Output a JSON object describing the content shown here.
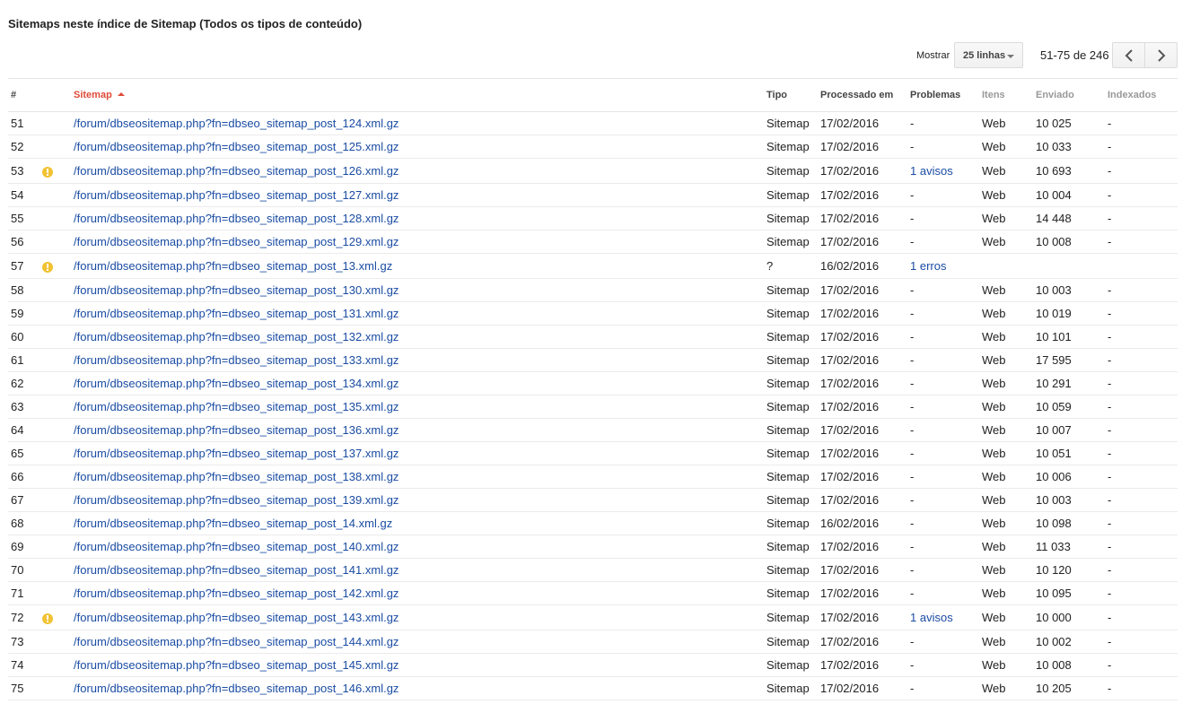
{
  "title": "Sitemaps neste índice de Sitemap (Todos os tipos de conteúdo)",
  "controls": {
    "show_label": "Mostrar",
    "rows_value": "25 linhas",
    "pager_text": "51-75 de 246"
  },
  "columns": {
    "num": "#",
    "sitemap": "Sitemap",
    "type": "Tipo",
    "processed": "Processado em",
    "issues": "Problemas",
    "items": "Itens",
    "submitted": "Enviado",
    "indexed": "Indexados"
  },
  "colors": {
    "link": "#1a4ca3",
    "sorted_header": "#dd4b39",
    "warning": "#f1c232"
  },
  "rows": [
    {
      "num": "51",
      "warn": false,
      "url": "/forum/dbseositemap.php?fn=dbseo_sitemap_post_124.xml.gz",
      "type": "Sitemap",
      "processed": "17/02/2016",
      "issues": "-",
      "issues_link": false,
      "items": "Web",
      "submitted": "10 025",
      "indexed": "-"
    },
    {
      "num": "52",
      "warn": false,
      "url": "/forum/dbseositemap.php?fn=dbseo_sitemap_post_125.xml.gz",
      "type": "Sitemap",
      "processed": "17/02/2016",
      "issues": "-",
      "issues_link": false,
      "items": "Web",
      "submitted": "10 033",
      "indexed": "-"
    },
    {
      "num": "53",
      "warn": true,
      "url": "/forum/dbseositemap.php?fn=dbseo_sitemap_post_126.xml.gz",
      "type": "Sitemap",
      "processed": "17/02/2016",
      "issues": "1 avisos",
      "issues_link": true,
      "items": "Web",
      "submitted": "10 693",
      "indexed": "-"
    },
    {
      "num": "54",
      "warn": false,
      "url": "/forum/dbseositemap.php?fn=dbseo_sitemap_post_127.xml.gz",
      "type": "Sitemap",
      "processed": "17/02/2016",
      "issues": "-",
      "issues_link": false,
      "items": "Web",
      "submitted": "10 004",
      "indexed": "-"
    },
    {
      "num": "55",
      "warn": false,
      "url": "/forum/dbseositemap.php?fn=dbseo_sitemap_post_128.xml.gz",
      "type": "Sitemap",
      "processed": "17/02/2016",
      "issues": "-",
      "issues_link": false,
      "items": "Web",
      "submitted": "14 448",
      "indexed": "-"
    },
    {
      "num": "56",
      "warn": false,
      "url": "/forum/dbseositemap.php?fn=dbseo_sitemap_post_129.xml.gz",
      "type": "Sitemap",
      "processed": "17/02/2016",
      "issues": "-",
      "issues_link": false,
      "items": "Web",
      "submitted": "10 008",
      "indexed": "-"
    },
    {
      "num": "57",
      "warn": true,
      "url": "/forum/dbseositemap.php?fn=dbseo_sitemap_post_13.xml.gz",
      "type": "?",
      "processed": "16/02/2016",
      "issues": "1 erros",
      "issues_link": true,
      "items": "",
      "submitted": "",
      "indexed": ""
    },
    {
      "num": "58",
      "warn": false,
      "url": "/forum/dbseositemap.php?fn=dbseo_sitemap_post_130.xml.gz",
      "type": "Sitemap",
      "processed": "17/02/2016",
      "issues": "-",
      "issues_link": false,
      "items": "Web",
      "submitted": "10 003",
      "indexed": "-"
    },
    {
      "num": "59",
      "warn": false,
      "url": "/forum/dbseositemap.php?fn=dbseo_sitemap_post_131.xml.gz",
      "type": "Sitemap",
      "processed": "17/02/2016",
      "issues": "-",
      "issues_link": false,
      "items": "Web",
      "submitted": "10 019",
      "indexed": "-"
    },
    {
      "num": "60",
      "warn": false,
      "url": "/forum/dbseositemap.php?fn=dbseo_sitemap_post_132.xml.gz",
      "type": "Sitemap",
      "processed": "17/02/2016",
      "issues": "-",
      "issues_link": false,
      "items": "Web",
      "submitted": "10 101",
      "indexed": "-"
    },
    {
      "num": "61",
      "warn": false,
      "url": "/forum/dbseositemap.php?fn=dbseo_sitemap_post_133.xml.gz",
      "type": "Sitemap",
      "processed": "17/02/2016",
      "issues": "-",
      "issues_link": false,
      "items": "Web",
      "submitted": "17 595",
      "indexed": "-"
    },
    {
      "num": "62",
      "warn": false,
      "url": "/forum/dbseositemap.php?fn=dbseo_sitemap_post_134.xml.gz",
      "type": "Sitemap",
      "processed": "17/02/2016",
      "issues": "-",
      "issues_link": false,
      "items": "Web",
      "submitted": "10 291",
      "indexed": "-"
    },
    {
      "num": "63",
      "warn": false,
      "url": "/forum/dbseositemap.php?fn=dbseo_sitemap_post_135.xml.gz",
      "type": "Sitemap",
      "processed": "17/02/2016",
      "issues": "-",
      "issues_link": false,
      "items": "Web",
      "submitted": "10 059",
      "indexed": "-"
    },
    {
      "num": "64",
      "warn": false,
      "url": "/forum/dbseositemap.php?fn=dbseo_sitemap_post_136.xml.gz",
      "type": "Sitemap",
      "processed": "17/02/2016",
      "issues": "-",
      "issues_link": false,
      "items": "Web",
      "submitted": "10 007",
      "indexed": "-"
    },
    {
      "num": "65",
      "warn": false,
      "url": "/forum/dbseositemap.php?fn=dbseo_sitemap_post_137.xml.gz",
      "type": "Sitemap",
      "processed": "17/02/2016",
      "issues": "-",
      "issues_link": false,
      "items": "Web",
      "submitted": "10 051",
      "indexed": "-"
    },
    {
      "num": "66",
      "warn": false,
      "url": "/forum/dbseositemap.php?fn=dbseo_sitemap_post_138.xml.gz",
      "type": "Sitemap",
      "processed": "17/02/2016",
      "issues": "-",
      "issues_link": false,
      "items": "Web",
      "submitted": "10 006",
      "indexed": "-"
    },
    {
      "num": "67",
      "warn": false,
      "url": "/forum/dbseositemap.php?fn=dbseo_sitemap_post_139.xml.gz",
      "type": "Sitemap",
      "processed": "17/02/2016",
      "issues": "-",
      "issues_link": false,
      "items": "Web",
      "submitted": "10 003",
      "indexed": "-"
    },
    {
      "num": "68",
      "warn": false,
      "url": "/forum/dbseositemap.php?fn=dbseo_sitemap_post_14.xml.gz",
      "type": "Sitemap",
      "processed": "16/02/2016",
      "issues": "-",
      "issues_link": false,
      "items": "Web",
      "submitted": "10 098",
      "indexed": "-"
    },
    {
      "num": "69",
      "warn": false,
      "url": "/forum/dbseositemap.php?fn=dbseo_sitemap_post_140.xml.gz",
      "type": "Sitemap",
      "processed": "17/02/2016",
      "issues": "-",
      "issues_link": false,
      "items": "Web",
      "submitted": "11 033",
      "indexed": "-"
    },
    {
      "num": "70",
      "warn": false,
      "url": "/forum/dbseositemap.php?fn=dbseo_sitemap_post_141.xml.gz",
      "type": "Sitemap",
      "processed": "17/02/2016",
      "issues": "-",
      "issues_link": false,
      "items": "Web",
      "submitted": "10 120",
      "indexed": "-"
    },
    {
      "num": "71",
      "warn": false,
      "url": "/forum/dbseositemap.php?fn=dbseo_sitemap_post_142.xml.gz",
      "type": "Sitemap",
      "processed": "17/02/2016",
      "issues": "-",
      "issues_link": false,
      "items": "Web",
      "submitted": "10 095",
      "indexed": "-"
    },
    {
      "num": "72",
      "warn": true,
      "url": "/forum/dbseositemap.php?fn=dbseo_sitemap_post_143.xml.gz",
      "type": "Sitemap",
      "processed": "17/02/2016",
      "issues": "1 avisos",
      "issues_link": true,
      "items": "Web",
      "submitted": "10 000",
      "indexed": "-"
    },
    {
      "num": "73",
      "warn": false,
      "url": "/forum/dbseositemap.php?fn=dbseo_sitemap_post_144.xml.gz",
      "type": "Sitemap",
      "processed": "17/02/2016",
      "issues": "-",
      "issues_link": false,
      "items": "Web",
      "submitted": "10 002",
      "indexed": "-"
    },
    {
      "num": "74",
      "warn": false,
      "url": "/forum/dbseositemap.php?fn=dbseo_sitemap_post_145.xml.gz",
      "type": "Sitemap",
      "processed": "17/02/2016",
      "issues": "-",
      "issues_link": false,
      "items": "Web",
      "submitted": "10 008",
      "indexed": "-"
    },
    {
      "num": "75",
      "warn": false,
      "url": "/forum/dbseositemap.php?fn=dbseo_sitemap_post_146.xml.gz",
      "type": "Sitemap",
      "processed": "17/02/2016",
      "issues": "-",
      "issues_link": false,
      "items": "Web",
      "submitted": "10 205",
      "indexed": "-"
    }
  ]
}
